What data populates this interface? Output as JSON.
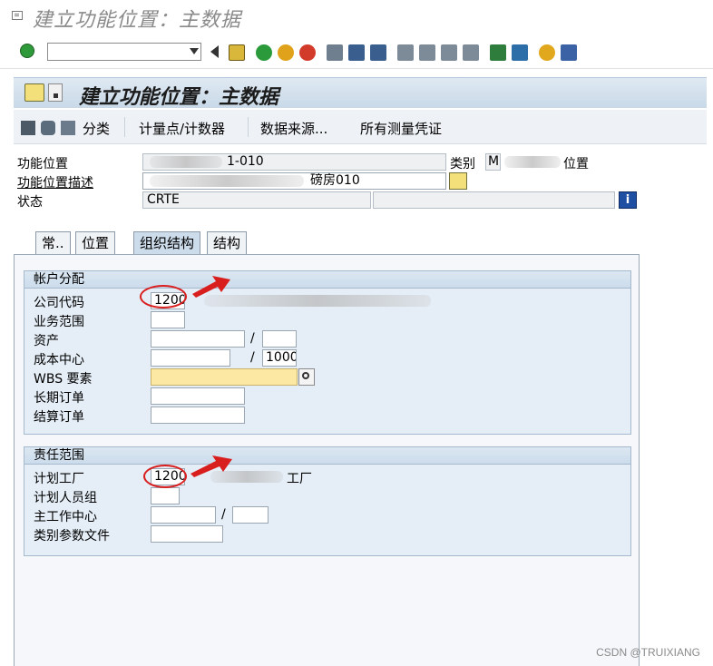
{
  "window": {
    "title": "建立功能位置：主数据"
  },
  "header": {
    "title": "建立功能位置：主数据"
  },
  "toolbar": {
    "items": [
      {
        "label": "分类"
      },
      {
        "label": "计量点/计数器"
      },
      {
        "label": "数据来源..."
      },
      {
        "label": "所有测量凭证"
      }
    ]
  },
  "fields": {
    "func_loc_label": "功能位置",
    "func_loc_value": "1-010",
    "category_label": "类别",
    "category_value": "M",
    "category_text": "位置",
    "desc_label": "功能位置描述",
    "desc_value": "磅房010",
    "status_label": "状态",
    "status_value": "CRTE"
  },
  "tabs": [
    {
      "label": "常.."
    },
    {
      "label": "位置"
    },
    {
      "label": "组织结构"
    },
    {
      "label": "结构"
    }
  ],
  "account_group": {
    "title": "帐户分配",
    "company_code_label": "公司代码",
    "company_code_value": "1200",
    "business_area_label": "业务范围",
    "asset_label": "资产",
    "cost_center_label": "成本中心",
    "cost_center_suffix": "1000",
    "wbs_label": "WBS 要素",
    "standing_order_label": "长期订单",
    "settlement_order_label": "结算订单"
  },
  "responsibility_group": {
    "title": "责任范围",
    "planning_plant_label": "计划工厂",
    "planning_plant_value": "1200",
    "planning_plant_text": "工厂",
    "planner_group_label": "计划人员组",
    "work_center_label": "主工作中心",
    "catalog_profile_label": "类别参数文件"
  },
  "watermark": "CSDN @TRUIXIANG",
  "colors": {
    "header_bg": "#c9d9e8",
    "panel_bg": "#e5eef7",
    "required_field": "#fde8a3",
    "annotation_red": "#d91e1e"
  }
}
